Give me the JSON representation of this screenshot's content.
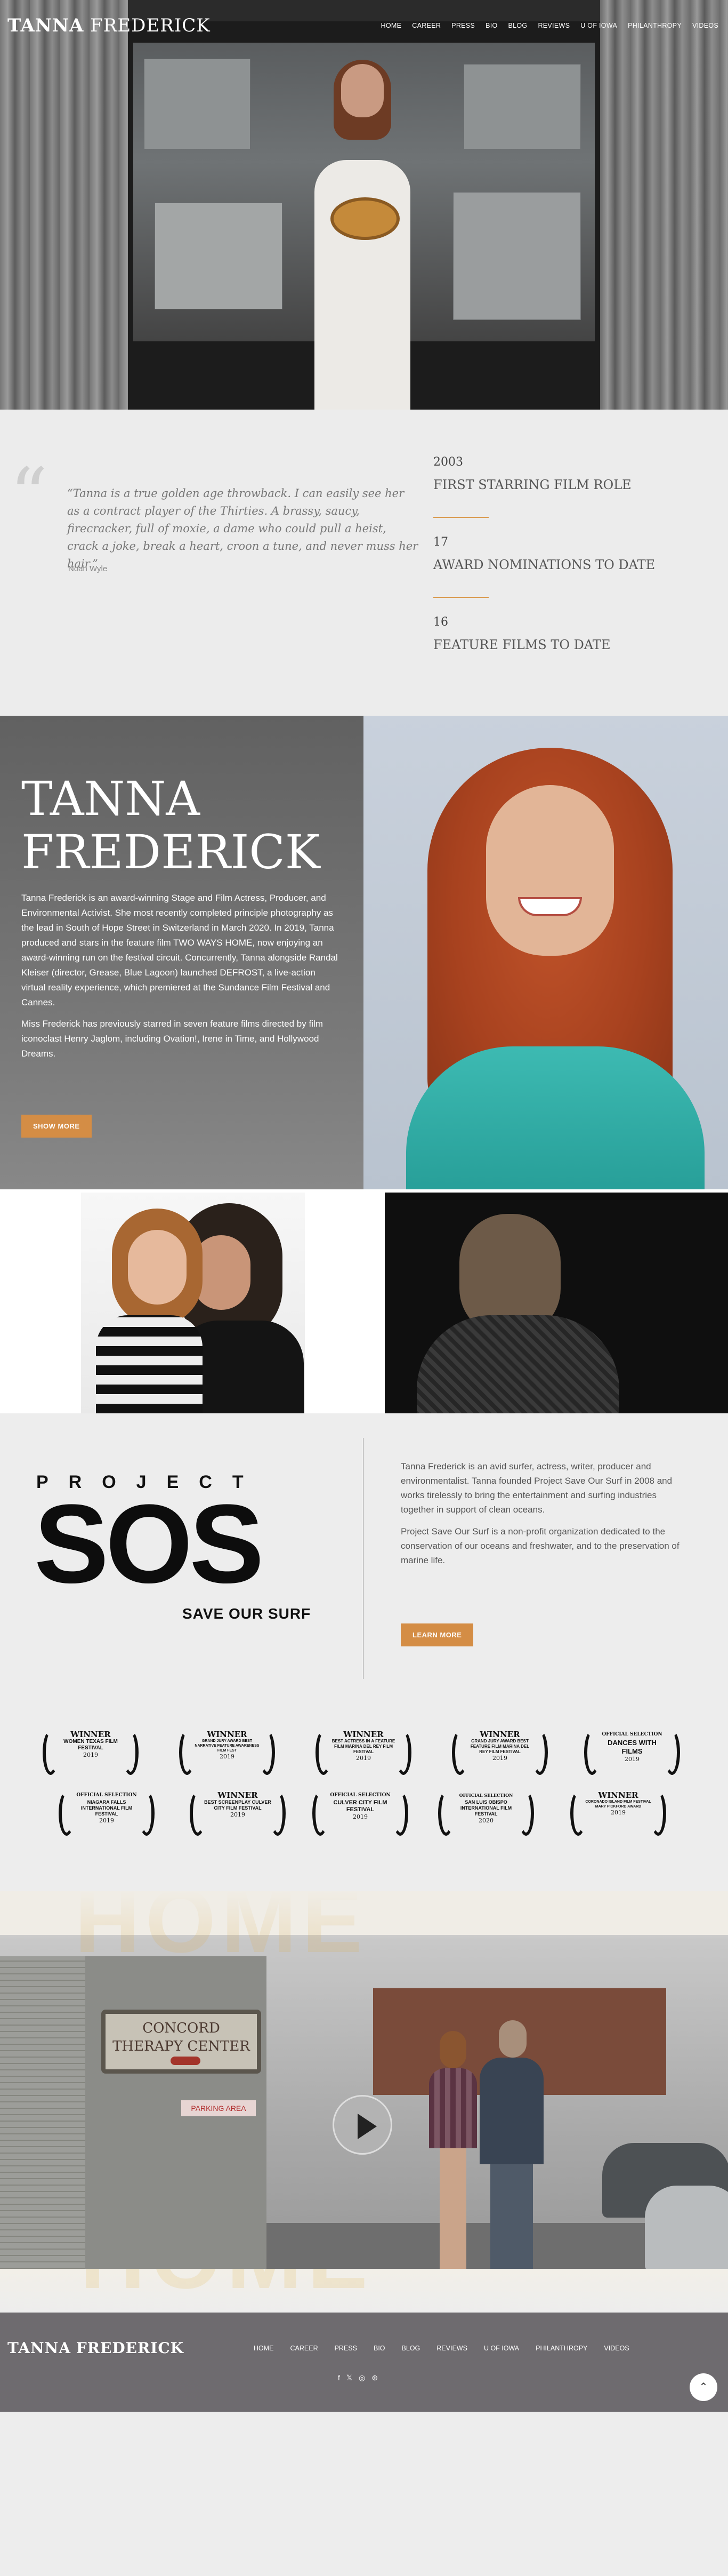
{
  "brand": {
    "first": "TANNA",
    "last": "FREDERICK"
  },
  "nav": [
    "HOME",
    "CAREER",
    "PRESS",
    "BIO",
    "BLOG",
    "REVIEWS",
    "U OF IOWA",
    "PHILANTHROPY",
    "VIDEOS"
  ],
  "quote": {
    "text": "“Tanna is a true golden age throwback. I can easily see her as a contract player of the Thirties. A brassy, saucy, firecracker, full of moxie, a dame who could pull a heist, crack a joke, break a heart, croon a tune, and never muss her hair.”",
    "author": "Noah Wyle"
  },
  "stats": [
    {
      "number": "2003",
      "label": "FIRST STARRING FILM ROLE"
    },
    {
      "number": "17",
      "label": "AWARD NOMINATIONS TO DATE"
    },
    {
      "number": "16",
      "label": "FEATURE FILMS TO DATE"
    }
  ],
  "bio": {
    "title_line1": "TANNA",
    "title_line2": "FREDERICK",
    "para1": "Tanna Frederick is an award-winning Stage and Film Actress, Producer, and Environmental Activist. She most recently completed principle photography as the lead in South of Hope Street in Switzerland in March 2020. In 2019, Tanna produced and stars in the feature film TWO WAYS HOME, now enjoying an award-winning run on the festival circuit. Concurrently, Tanna alongside Randal Kleiser (director, Grease, Blue Lagoon) launched DEFROST, a live-action virtual reality experience, which premiered at the Sundance Film Festival and Cannes.",
    "para2": "Miss Frederick has previously starred in seven feature films directed by film iconoclast Henry Jaglom, including Ovation!, Irene in Time, and Hollywood Dreams.",
    "button": "SHOW MORE"
  },
  "sos": {
    "project": "PROJECT",
    "logo": "SOS",
    "tagline": "SAVE OUR SURF",
    "para1": "Tanna Frederick is an avid surfer, actress, writer, producer and environmentalist. Tanna founded Project Save Our Surf in 2008 and works tirelessly to bring the entertainment and surfing industries together in support of clean oceans.",
    "para2": "Project Save Our Surf is a non-profit organization dedicated to the conservation of our oceans and freshwater, and to the preservation of marine life.",
    "button": "LEARN MORE"
  },
  "awards": [
    {
      "top": "WINNER",
      "mid": "WOMEN TEXAS FILM FESTIVAL",
      "year": "2019"
    },
    {
      "top": "WINNER",
      "mid": "GRAND JURY AWARD BEST NARRATIVE FEATURE AWARENESS FILM FEST",
      "year": "2019"
    },
    {
      "top": "WINNER",
      "mid": "BEST ACTRESS IN A FEATURE FILM Marina del Rey Film Festival",
      "year": "2019"
    },
    {
      "top": "WINNER",
      "mid": "GRAND JURY AWARD BEST FEATURE FILM Marina del Rey Film Festival",
      "year": "2019"
    },
    {
      "top": "OFFICIAL SELECTION",
      "mid": "DANCES WITH FILMS",
      "year": "2019"
    },
    {
      "top": "OFFICIAL SELECTION",
      "mid": "NIAGARA FALLS INTERNATIONAL FILM FESTIVAL",
      "year": "2019"
    },
    {
      "top": "WINNER",
      "mid": "BEST SCREENPLAY CULVER CITY FILM FESTIVAL",
      "year": "2019"
    },
    {
      "top": "OFFICIAL SELECTION",
      "mid": "CULVER CITY FILM FESTIVAL",
      "year": "2019"
    },
    {
      "top": "OFFICIAL SELECTION",
      "mid": "SAN LUIS OBISPO INTERNATIONAL FILM FESTIVAL",
      "year": "2020"
    },
    {
      "top": "WINNER",
      "mid": "CORONADO ISLAND FILM FESTIVAL MARY PICKFORD AWARD",
      "year": "2019"
    }
  ],
  "video": {
    "sign_line1": "CONCORD",
    "sign_line2": "THERAPY CENTER",
    "parking": "PARKING AREA",
    "ghost": "HOME"
  },
  "footer": {
    "nav": [
      "HOME",
      "CAREER",
      "PRESS",
      "BIO",
      "BLOG",
      "REVIEWS",
      "U OF IOWA",
      "PHILANTHROPY",
      "VIDEOS"
    ],
    "social": [
      "f",
      "𝕏",
      "◎",
      "⊕"
    ]
  },
  "colors": {
    "accent": "#d48d45",
    "footer_bg": "#6e6b6f",
    "bio_bg": "#6e6e6e"
  }
}
